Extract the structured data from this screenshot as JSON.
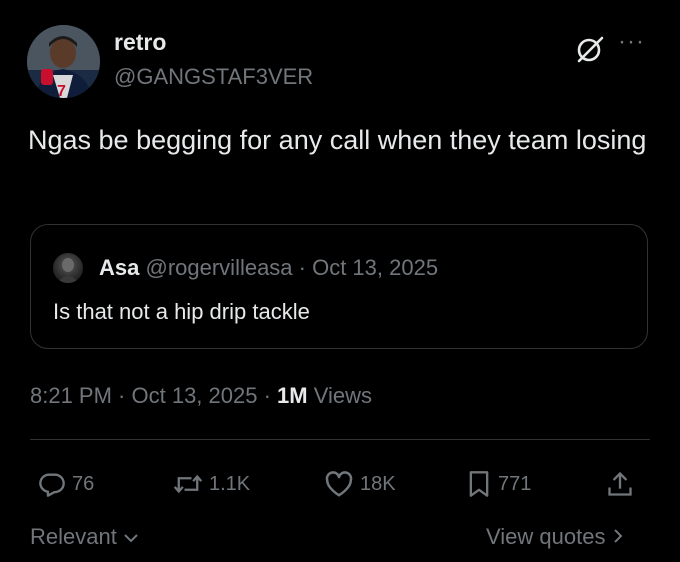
{
  "author": {
    "display_name": "retro",
    "handle": "@GANGSTAF3VER"
  },
  "post": {
    "text": "Ngas be begging for any call when they team losing"
  },
  "quote": {
    "name": "Asa",
    "meta": "@rogervilleasa · Oct 13, 2025",
    "text": "Is that not a hip drip tackle"
  },
  "meta": {
    "time": "8:21 PM",
    "sep1": " · ",
    "date": "Oct 13, 2025",
    "sep2": " · ",
    "views_count": "1M",
    "views_label": " Views"
  },
  "actions": {
    "replies": "76",
    "reposts": "1.1K",
    "likes": "18K",
    "bookmarks": "771"
  },
  "footer": {
    "sort_label": "Relevant",
    "view_quotes": "View quotes"
  },
  "icons": {
    "grok": "grok-icon",
    "more": "more-icon",
    "reply": "reply-icon",
    "repost": "repost-icon",
    "like": "heart-icon",
    "bookmark": "bookmark-icon",
    "share": "share-icon",
    "chevron_down": "chevron-down-icon",
    "chevron_right": "chevron-right-icon"
  },
  "colors": {
    "background": "#000000",
    "text": "#e7e9ea",
    "secondary": "#71767b",
    "border": "#2f3336"
  }
}
